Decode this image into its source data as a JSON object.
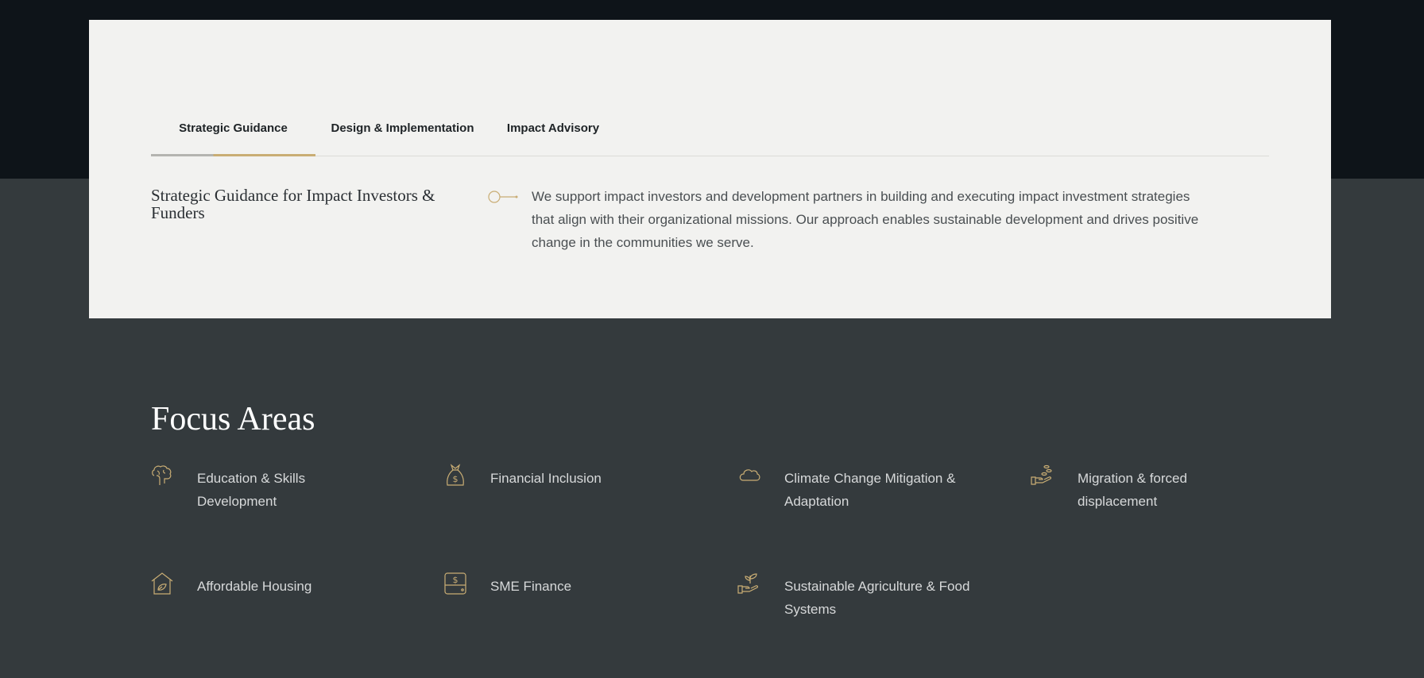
{
  "tabs": [
    {
      "label": "Strategic Guidance",
      "active": true
    },
    {
      "label": "Design & Implementation",
      "active": false
    },
    {
      "label": "Impact Advisory",
      "active": false
    }
  ],
  "panel": {
    "title": "Strategic Guidance for Impact Investors & Funders",
    "description": "We support impact investors and development partners in building and executing impact investment strategies that align with their organizational missions. Our approach enables sustainable development and drives positive change in the communities we serve.",
    "icon": "key-icon"
  },
  "focus": {
    "title": "Focus Areas",
    "items": [
      {
        "label": "Education & Skills Development",
        "icon": "brain-icon"
      },
      {
        "label": "Financial Inclusion",
        "icon": "money-bag-icon"
      },
      {
        "label": "Climate Change Mitigation & Adaptation",
        "icon": "cloud-icon"
      },
      {
        "label": "Migration & forced displacement",
        "icon": "hand-coins-icon"
      },
      {
        "label": "Affordable Housing",
        "icon": "house-leaf-icon"
      },
      {
        "label": "SME Finance",
        "icon": "wallet-dollar-icon"
      },
      {
        "label": "Sustainable Agriculture & Food Systems",
        "icon": "hand-sprout-icon"
      }
    ]
  },
  "colors": {
    "accent": "#c9ad74",
    "dark_band": "#0e1419",
    "section_bg": "#343a3d",
    "card_bg": "#f2f2f0"
  }
}
